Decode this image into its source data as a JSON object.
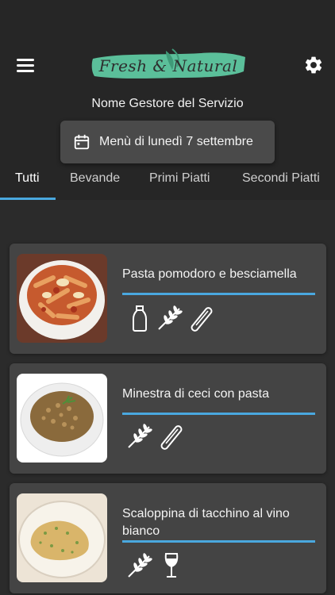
{
  "header": {
    "logo_text": "Fresh & Natural",
    "service_name": "Nome Gestore del Servizio",
    "date_label": "Menù di lunedì 7 settembre"
  },
  "tabs": [
    {
      "label": "Tutti",
      "active": true
    },
    {
      "label": "Bevande",
      "active": false
    },
    {
      "label": "Primi Piatti",
      "active": false
    },
    {
      "label": "Secondi Piatti",
      "active": false
    }
  ],
  "colors": {
    "accent": "#4aa8df",
    "background": "#2b2b2b",
    "card": "#444444",
    "logo_brush": "#5bbf9a"
  },
  "dishes": [
    {
      "name": "Pasta pomodoro e besciamella",
      "allergens": [
        "milk-icon",
        "wheat-icon",
        "celery-icon"
      ]
    },
    {
      "name": "Minestra di ceci con pasta",
      "allergens": [
        "wheat-icon",
        "celery-icon"
      ]
    },
    {
      "name": "Scaloppina di tacchino  al vino bianco",
      "allergens": [
        "wheat-icon",
        "wine-glass-icon"
      ]
    }
  ]
}
